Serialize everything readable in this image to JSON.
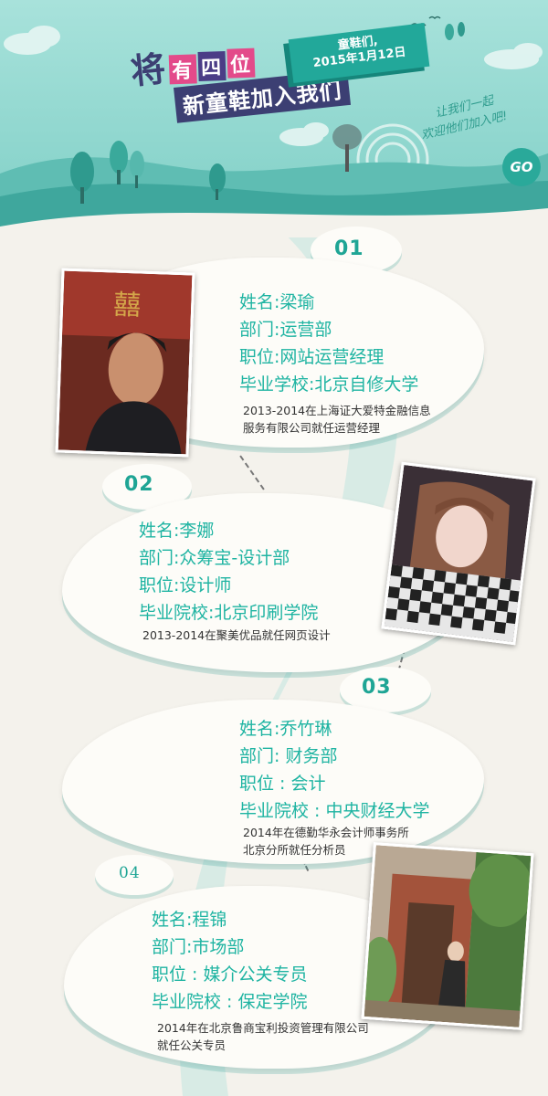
{
  "header": {
    "title_prefix": "将",
    "title_highlight": [
      "有",
      "四",
      "位"
    ],
    "title_line2": "新童鞋加入我们",
    "date_line1": "童鞋们,",
    "date_line2": "2015年1月12日",
    "slogan_line1": "让我们一起",
    "slogan_line2": "欢迎他们加入吧!",
    "go_label": "GO"
  },
  "members": [
    {
      "number": "01",
      "name": "姓名:梁瑜",
      "dept": "部门:运营部",
      "position": "职位:网站运营经理",
      "school": "毕业学校:北京自修大学",
      "note_line1": "2013-2014在上海证大爱特金融信息",
      "note_line2": "服务有限公司就任运营经理"
    },
    {
      "number": "02",
      "name": "姓名:李娜",
      "dept": "部门:众筹宝-设计部",
      "position": "职位:设计师",
      "school": "毕业院校:北京印刷学院",
      "note_line1": "2013-2014在聚美优品就任网页设计",
      "note_line2": ""
    },
    {
      "number": "03",
      "name": "姓名:乔竹琳",
      "dept": "部门: 财务部",
      "position": "职位 : 会计",
      "school": "毕业院校 : 中央财经大学",
      "note_line1": "2014年在德勤华永会计师事务所",
      "note_line2": "北京分所就任分析员"
    },
    {
      "number": "04",
      "name": "姓名:程锦",
      "dept": "部门:市场部",
      "position": "职位 : 媒介公关专员",
      "school": "毕业院校 : 保定学院",
      "note_line1": "2014年在北京鲁商宝利投资管理有限公司",
      "note_line2": "就任公关专员"
    }
  ],
  "colors": {
    "sky": "#8fd9d2",
    "accent": "#1fa595",
    "title_dark": "#3c3f73",
    "highlight_pink": "#e34a8a",
    "text_body": "#333333",
    "background": "#f4f2ec"
  }
}
